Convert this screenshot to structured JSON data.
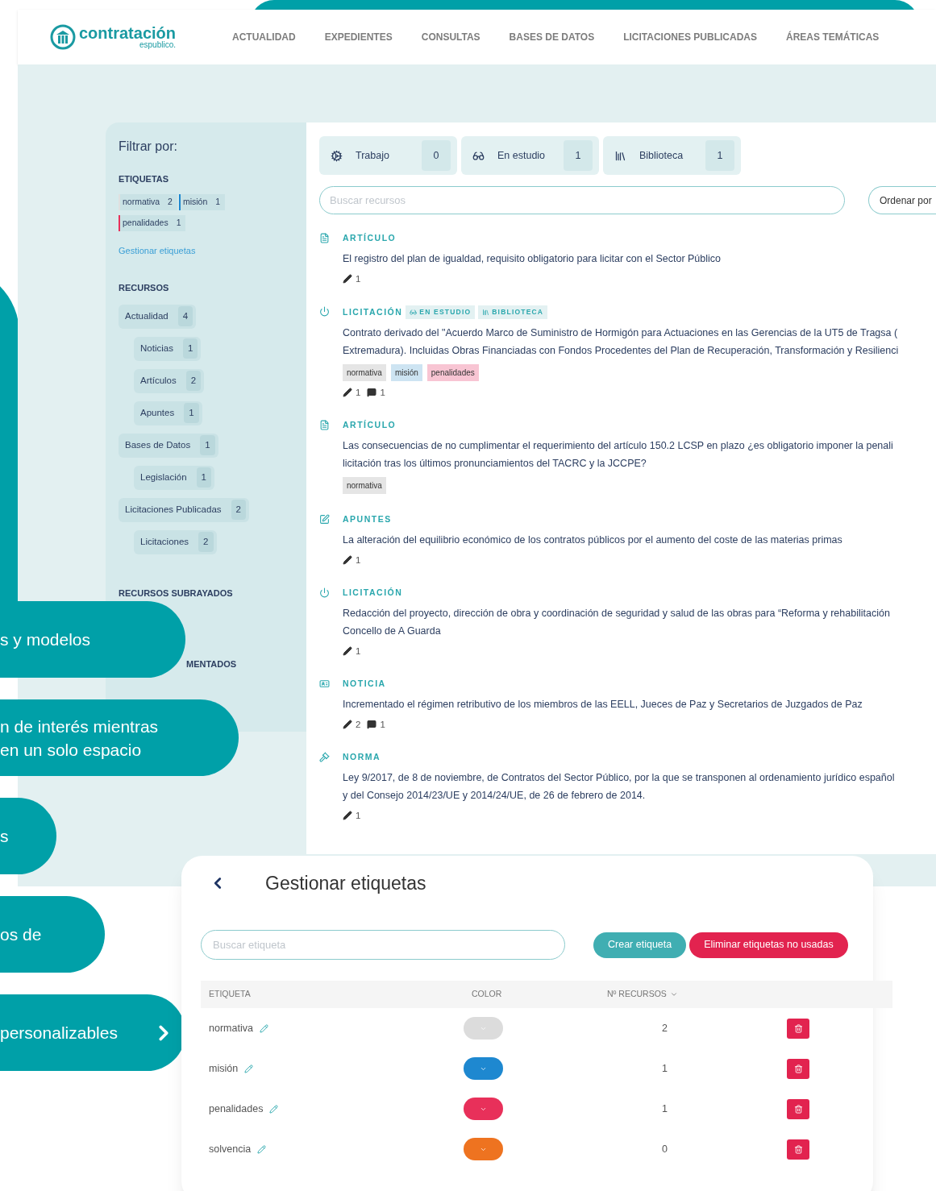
{
  "header": {
    "logo": {
      "name": "contratación",
      "sub": "espublico."
    },
    "nav": [
      "ACTUALIDAD",
      "EXPEDIENTES",
      "CONSULTAS",
      "BASES DE DATOS",
      "LICITACIONES PUBLICADAS",
      "ÁREAS TEMÁTICAS"
    ]
  },
  "sidebar": {
    "title": "Filtrar por:",
    "tags_heading": "ETIQUETAS",
    "tags": [
      {
        "label": "normativa",
        "count": "2",
        "color": "#e0e0e0"
      },
      {
        "label": "misión",
        "count": "1",
        "color": "#1e88d0"
      },
      {
        "label": "penalidades",
        "count": "1",
        "color": "#e8305a"
      }
    ],
    "manage_link": "Gestionar etiquetas",
    "resources_heading": "RECURSOS",
    "resources": [
      {
        "label": "Actualidad",
        "count": "4",
        "children": [
          {
            "label": "Noticias",
            "count": "1"
          },
          {
            "label": "Artículos",
            "count": "2"
          },
          {
            "label": "Apuntes",
            "count": "1"
          }
        ]
      },
      {
        "label": "Bases de Datos",
        "count": "1",
        "children": [
          {
            "label": "Legislación",
            "count": "1"
          }
        ]
      },
      {
        "label": "Licitaciones Publicadas",
        "count": "2",
        "children": [
          {
            "label": "Licitaciones",
            "count": "2"
          }
        ]
      }
    ],
    "underlined_heading": "RECURSOS SUBRAYADOS",
    "commented_heading": "MENTADOS"
  },
  "lists": [
    {
      "kind": "work",
      "label": "Trabajo",
      "count": "0"
    },
    {
      "kind": "study",
      "label": "En estudio",
      "count": "1"
    },
    {
      "kind": "library",
      "label": "Biblioteca",
      "count": "1"
    }
  ],
  "search": {
    "placeholder": "Buscar recursos"
  },
  "sort_button": "Ordenar por",
  "items": [
    {
      "kind": "article",
      "type": "ARTÍCULO",
      "title": [
        "El registro del plan de igualdad, requisito obligatorio para licitar con el Sector Público"
      ],
      "notes": "1"
    },
    {
      "kind": "tender",
      "type": "LICITACIÓN",
      "badges": [
        {
          "kind": "study",
          "label": "EN ESTUDIO"
        },
        {
          "kind": "library",
          "label": "BIBLIOTECA"
        }
      ],
      "title": [
        "Contrato derivado del \"Acuerdo Marco de Suministro de Hormigón para Actuaciones en las Gerencias de la UT5 de Tragsa (",
        "Extremadura). Incluidas Obras Financiadas con Fondos Procedentes del Plan de Recuperación, Transformación y Resilienci"
      ],
      "tags": [
        {
          "label": "normativa",
          "color": "#e5e5e5"
        },
        {
          "label": "misión",
          "color": "#cde4f2"
        },
        {
          "label": "penalidades",
          "color": "#f8c5d3"
        }
      ],
      "notes": "1",
      "comments": "1"
    },
    {
      "kind": "article",
      "type": "ARTÍCULO",
      "title": [
        "Las consecuencias de no cumplimentar el requerimiento del artículo 150.2 LCSP en plazo ¿es obligatorio imponer la penali",
        "licitación tras los últimos pronunciamientos del TACRC y la JCCPE?"
      ],
      "tags": [
        {
          "label": "normativa",
          "color": "#e5e5e5"
        }
      ]
    },
    {
      "kind": "notes",
      "type": "APUNTES",
      "title": [
        "La alteración del equilibrio económico de los contratos públicos por el aumento del coste de las materias primas"
      ],
      "notes": "1"
    },
    {
      "kind": "tender",
      "type": "LICITACIÓN",
      "title": [
        "Redacción del proyecto, dirección de obra y coordinación de seguridad y salud de las obras para “Reforma y rehabilitación",
        "Concello de A Guarda"
      ],
      "notes": "1"
    },
    {
      "kind": "news",
      "type": "NOTICIA",
      "title": [
        "Incrementado el régimen retributivo de los miembros de las EELL, Jueces de Paz y Secretarios de Juzgados de Paz"
      ],
      "notes": "2",
      "comments": "1"
    },
    {
      "kind": "norm",
      "type": "NORMA",
      "title": [
        "Ley 9/2017, de 8 de noviembre, de Contratos del Sector Público, por la que se transponen al ordenamiento jurídico español",
        "y del Consejo 2014/23/UE y 2014/24/UE, de 26 de febrero de 2014."
      ],
      "notes": "1"
    }
  ],
  "promos": [
    {
      "lines": [
        "s y modelos"
      ],
      "arrow": false
    },
    {
      "lines": [
        "n de interés mientras",
        "en un solo espacio"
      ],
      "arrow": false
    },
    {
      "lines": [
        "s"
      ],
      "arrow": false
    },
    {
      "lines": [
        "os de"
      ],
      "arrow": false
    },
    {
      "lines": [
        "personalizables"
      ],
      "arrow": true
    }
  ],
  "modal": {
    "title": "Gestionar etiquetas",
    "search_placeholder": "Buscar etiqueta",
    "buttons": [
      {
        "kind": "primary",
        "label": "Crear etiqueta"
      },
      {
        "kind": "danger",
        "label": "Eliminar etiquetas no usadas"
      }
    ],
    "columns": [
      "ETIQUETA",
      "COLOR",
      "Nº RECURSOS"
    ],
    "rows": [
      {
        "label": "normativa",
        "color": "#dcdcdc",
        "count": "2"
      },
      {
        "label": "misión",
        "color": "#1e88d0",
        "count": "1"
      },
      {
        "label": "penalidades",
        "color": "#e8305a",
        "count": "1"
      },
      {
        "label": "solvencia",
        "color": "#ee7320",
        "count": "0"
      }
    ]
  }
}
